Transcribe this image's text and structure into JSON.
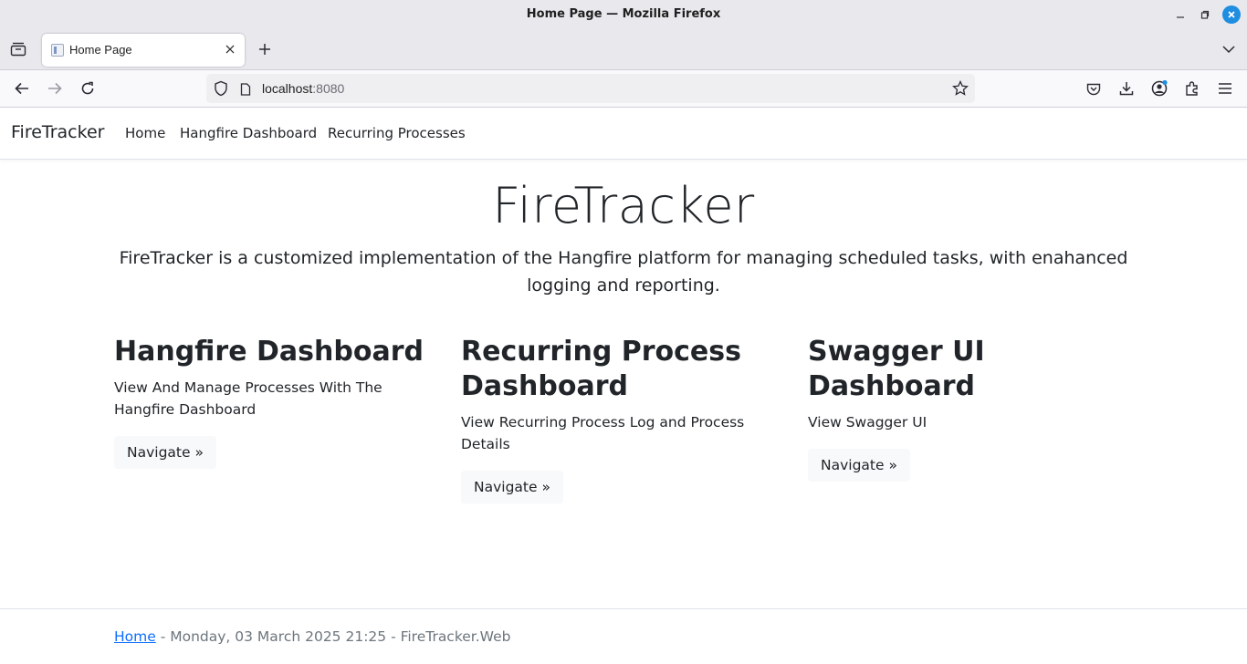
{
  "window": {
    "title": "Home Page — Mozilla Firefox"
  },
  "browser": {
    "tab_title": "Home Page",
    "url_host": "localhost",
    "url_port": ":8080"
  },
  "site": {
    "brand": "FireTracker",
    "nav": [
      "Home",
      "Hangfire Dashboard",
      "Recurring Processes"
    ],
    "hero_title": "FireTracker",
    "hero_lead": "FireTracker is a customized implementation of the Hangfire platform for managing scheduled tasks, with enahanced logging and reporting.",
    "cards": [
      {
        "title": "Hangfire Dashboard",
        "text": "View And Manage Processes With The Hangfire Dashboard",
        "button": "Navigate »"
      },
      {
        "title": "Recurring Process Dashboard",
        "text": "View Recurring Process Log and Process Details",
        "button": "Navigate »"
      },
      {
        "title": "Swagger UI Dashboard",
        "text": "View Swagger UI",
        "button": "Navigate »"
      }
    ],
    "footer": {
      "link": "Home",
      "text": " - Monday, 03 March 2025 21:25 - FireTracker.Web"
    }
  }
}
